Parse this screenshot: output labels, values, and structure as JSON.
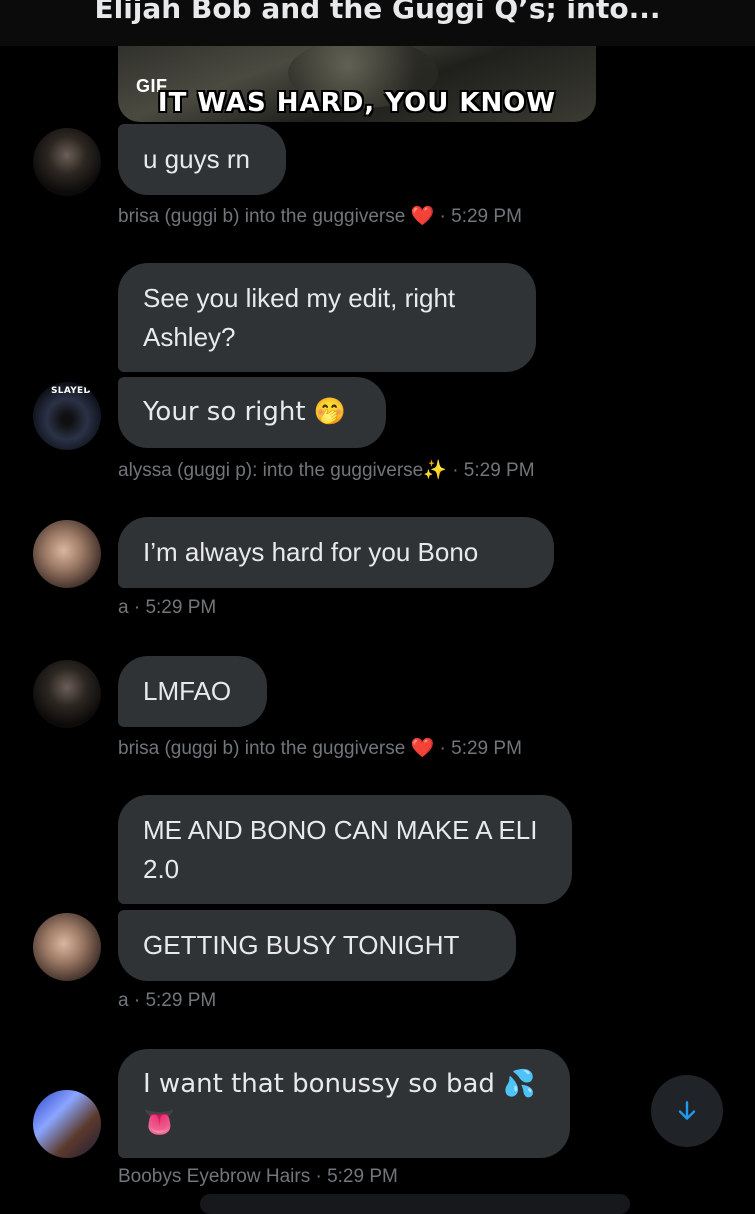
{
  "header": {
    "title": "Elijah Bob and the Guggi Q’s; into..."
  },
  "gif": {
    "badge": "GIF",
    "caption": "IT WAS HARD, YOU KNOW"
  },
  "messages": [
    {
      "text": "u guys rn"
    },
    {
      "text": "See you liked my edit, right Ashley?"
    },
    {
      "text": "Your so right 🤭"
    },
    {
      "text": "I’m always hard for you Bono"
    },
    {
      "text": "LMFAO"
    },
    {
      "text": "ME AND BONO CAN MAKE A ELI 2.0"
    },
    {
      "text": "GETTING BUSY TONIGHT"
    },
    {
      "text": "I want that bonussy so bad 💦 👅"
    }
  ],
  "meta": [
    {
      "sender": "brisa (guggi b) into the guggiverse",
      "emoji": "❤️",
      "time": "· 5:29 PM"
    },
    {
      "sender": "alyssa (guggi p): into the guggiverse✨",
      "time": "· 5:29 PM"
    },
    {
      "sender": "a",
      "time": "· 5:29 PM"
    },
    {
      "sender": "brisa (guggi b) into the guggiverse",
      "emoji": "❤️",
      "time": "· 5:29 PM"
    },
    {
      "sender": "a",
      "time": "· 5:29 PM"
    },
    {
      "sender": "Boobys Eyebrow Hairs",
      "time": "· 5:29 PM"
    }
  ],
  "avatars": {
    "alyssa_badge": "SLAYED"
  },
  "icons": {
    "scroll_down": "arrow-down-icon"
  },
  "colors": {
    "bubble": "#2f3336",
    "accent": "#1d9bf0",
    "heart": "#e0245e"
  }
}
